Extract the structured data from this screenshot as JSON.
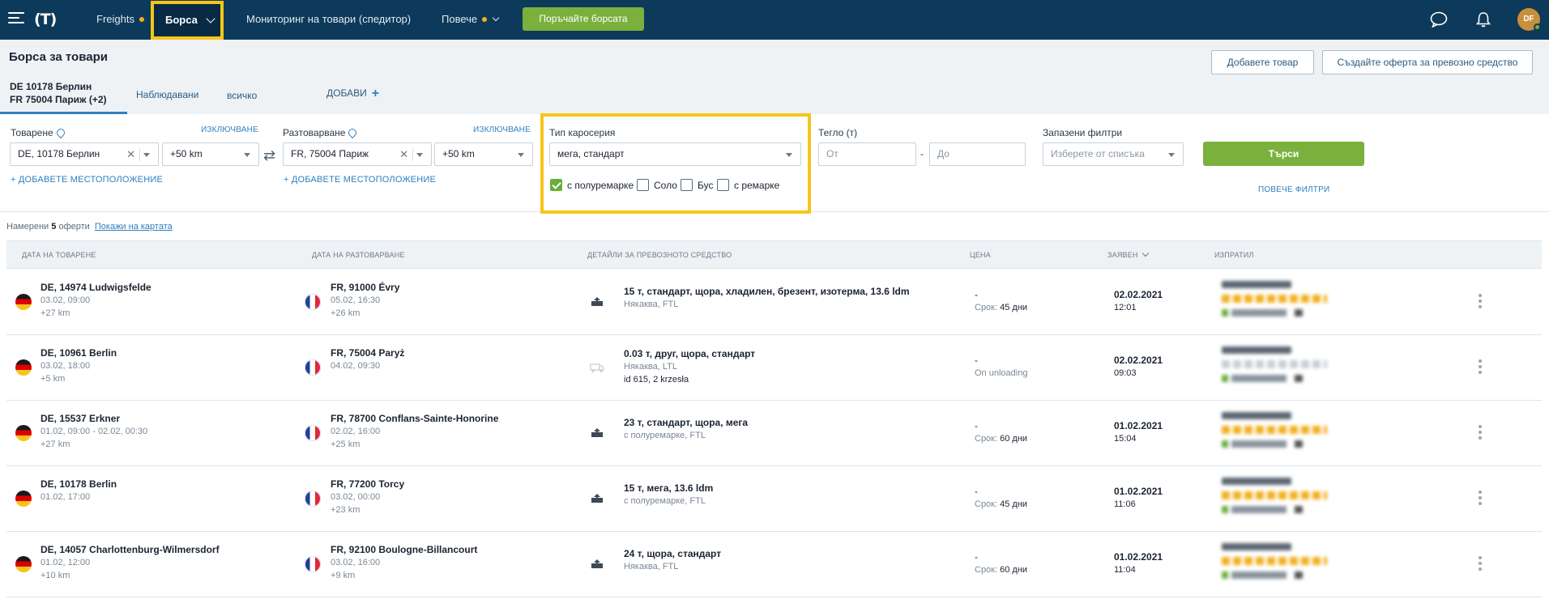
{
  "nav": {
    "items": [
      {
        "label": "Freights",
        "dot": true
      },
      {
        "label": "Борса",
        "active": true
      },
      {
        "label": "Мониторинг на товари (спедитор)"
      },
      {
        "label": "Повече",
        "dot": true
      }
    ],
    "cta": "Поръчайте борсата",
    "avatar": "DF",
    "icons": [
      "menu-icon",
      "logo",
      "chat-icon",
      "bell-icon"
    ]
  },
  "subheader": {
    "title": "Борса за товари",
    "add_cargo": "Добавете товар",
    "create_offer": "Създайте оферта за превозно средство",
    "tabs": [
      {
        "line1": "DE 10178 Берлин",
        "line2": "FR 75004 Париж (+2)"
      },
      {
        "label": "Наблюдавани"
      },
      {
        "label": "всичко"
      },
      {
        "label": "ДОБАВИ"
      }
    ]
  },
  "filters": {
    "loading": {
      "label": "Товарене",
      "exclude": "ИЗКЛЮЧВАНЕ",
      "value": "DE, 10178 Берлин",
      "radius": "+50 km",
      "add": "ДОБАВЕТЕ МЕСТОПОЛОЖЕНИЕ"
    },
    "unloading": {
      "label": "Разтоварване",
      "exclude": "ИЗКЛЮЧВАНЕ",
      "value": "FR, 75004 Париж",
      "radius": "+50 km",
      "add": "ДОБАВЕТЕ МЕСТОПОЛОЖЕНИЕ"
    },
    "body": {
      "label": "Тип каросерия",
      "value": "мега, стандарт",
      "options": [
        {
          "label": "с полуремарке",
          "checked": true
        },
        {
          "label": "Соло",
          "checked": false
        },
        {
          "label": "Бус",
          "checked": false
        },
        {
          "label": "с ремарке",
          "checked": false
        }
      ]
    },
    "weight": {
      "label": "Тегло (т)",
      "from": "От",
      "to": "До",
      "dash": "-"
    },
    "saved": {
      "label": "Запазени филтри",
      "placeholder": "Изберете от списъка"
    },
    "search": "Търси",
    "more": "ПОВЕЧЕ ФИЛТРИ"
  },
  "results": {
    "found_prefix": "Намерени",
    "count": "5",
    "found_suffix": "оферти",
    "map_link": "Покажи на картата",
    "headers": [
      "ДАТА НА ТОВАРЕНЕ",
      "ДАТА НА РАЗТОВАРВАНЕ",
      "ДЕТАЙЛИ ЗА ПРЕВОЗНОТО СРЕДСТВО",
      "ЦЕНА",
      "ЗАЯВЕН",
      "ИЗПРАТИЛ"
    ],
    "rows": [
      {
        "from": "DE, 14974 Ludwigsfelde",
        "from_date": "03.02, 09:00",
        "from_km": "+27 km",
        "to": "FR, 91000 Évry",
        "to_date": "05.02, 16:30",
        "to_km": "+26 km",
        "vehicle": "15 т, стандарт, щора, хладилен, брезент, изотерма, 13.6 ldm",
        "vehicle_sub": "Някаква, FTL",
        "vehicle_extra": "",
        "price": "-",
        "term_label": "Срок:",
        "term_value": "45 дни",
        "date": "02.02.2021",
        "time": "12:01"
      },
      {
        "from": "DE, 10961 Berlin",
        "from_date": "03.02, 18:00",
        "from_km": "+5 km",
        "to": "FR, 75004 Paryż",
        "to_date": "04.02, 09:30",
        "to_km": "",
        "vehicle": "0.03 т, друг, щора, стандарт",
        "vehicle_sub": "Някаква, LTL",
        "vehicle_extra": "id 615, 2 krzesła",
        "price": "-",
        "term_label": "On unloading",
        "term_value": "",
        "date": "02.02.2021",
        "time": "09:03"
      },
      {
        "from": "DE, 15537 Erkner",
        "from_date": "01.02, 09:00 - 02.02, 00:30",
        "from_km": "+27 km",
        "to": "FR, 78700 Conflans-Sainte-Honorine",
        "to_date": "02.02, 16:00",
        "to_km": "+25 km",
        "vehicle": "23 т, стандарт, щора, мега",
        "vehicle_sub": "с полуремарке, FTL",
        "vehicle_extra": "",
        "price": "-",
        "term_label": "Срок:",
        "term_value": "60 дни",
        "date": "01.02.2021",
        "time": "15:04"
      },
      {
        "from": "DE, 10178 Berlin",
        "from_date": "01.02, 17:00",
        "from_km": "",
        "to": "FR, 77200 Torcy",
        "to_date": "03.02, 00:00",
        "to_km": "+23 km",
        "vehicle": "15 т, мега, 13.6 ldm",
        "vehicle_sub": "с полуремарке, FTL",
        "vehicle_extra": "",
        "price": "-",
        "term_label": "Срок:",
        "term_value": "45 дни",
        "date": "01.02.2021",
        "time": "11:06"
      },
      {
        "from": "DE, 14057 Charlottenburg-Wilmersdorf",
        "from_date": "01.02, 12:00",
        "from_km": "+10 km",
        "to": "FR, 92100 Boulogne-Billancourt",
        "to_date": "03.02, 16:00",
        "to_km": "+9 km",
        "vehicle": "24 т, щора, стандарт",
        "vehicle_sub": "Някаква, FTL",
        "vehicle_extra": "",
        "price": "-",
        "term_label": "Срок:",
        "term_value": "60 дни",
        "date": "01.02.2021",
        "time": "11:04"
      }
    ]
  }
}
